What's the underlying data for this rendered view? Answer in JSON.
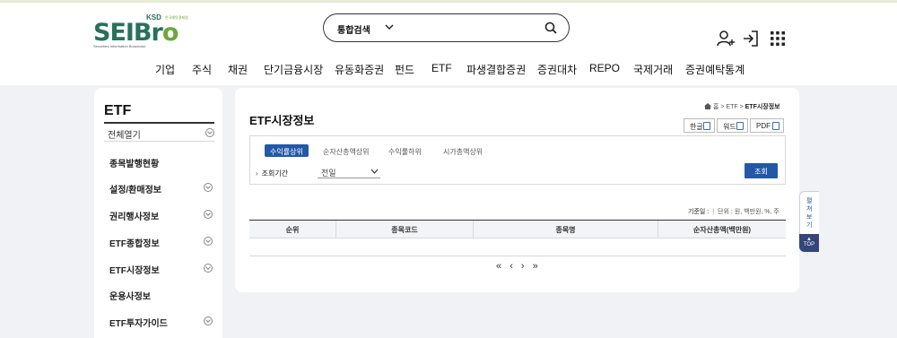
{
  "logo": {
    "main_text": "SEIBro",
    "ksd": "KSD",
    "ksd_sub": "한국예탁결제원",
    "sub": "Securities Information Broadcast"
  },
  "search": {
    "category": "통합검색",
    "placeholder": ""
  },
  "header_icons": [
    "login-user-icon",
    "sign-in-icon",
    "app-grid-icon"
  ],
  "nav": [
    "기업",
    "주식",
    "채권",
    "단기금융시장",
    "유동화증권",
    "펀드",
    "ETF",
    "파생결합증권",
    "증권대차",
    "REPO",
    "국제거래",
    "증권예탁통계"
  ],
  "sidebar": {
    "title": "ETF",
    "expand_all": "전체열기",
    "items": [
      {
        "label": "종목발행현황",
        "expandable": false
      },
      {
        "label": "설정/환매정보",
        "expandable": true
      },
      {
        "label": "권리행사정보",
        "expandable": true
      },
      {
        "label": "ETF종합정보",
        "expandable": true
      },
      {
        "label": "ETF시장정보",
        "expandable": true
      },
      {
        "label": "운용사정보",
        "expandable": false
      },
      {
        "label": "ETF투자가이드",
        "expandable": true
      }
    ]
  },
  "main": {
    "title": "ETF시장정보",
    "breadcrumb": {
      "home": "홈",
      "sep": ">",
      "level1": "ETF",
      "current": "ETF시장정보"
    },
    "downloads": [
      "한글",
      "워드",
      "PDF"
    ],
    "tabs": [
      {
        "label": "수익률상위",
        "active": true
      },
      {
        "label": "순자산총액상위",
        "active": false
      },
      {
        "label": "수익률하위",
        "active": false
      },
      {
        "label": "시가총액상위",
        "active": false
      }
    ],
    "filter_label": "조회기간",
    "period_value": "전일",
    "query_button": "조회",
    "meta": {
      "date_label": "기준일 :",
      "units": "단위 : 원, 백만원, %, 주"
    },
    "table_headers": [
      "순위",
      "종목코드",
      "종목명",
      "순자산총액(백만원)"
    ],
    "rows": [],
    "pager": [
      "«",
      "‹",
      "›",
      "»"
    ]
  },
  "side_tab": {
    "label": "펼쳐보기",
    "top": "TOP"
  },
  "colors": {
    "primary": "#2358a8",
    "logo_green": "#27715c",
    "logo_light": "#6aa83a",
    "top_btn": "#33457a"
  }
}
